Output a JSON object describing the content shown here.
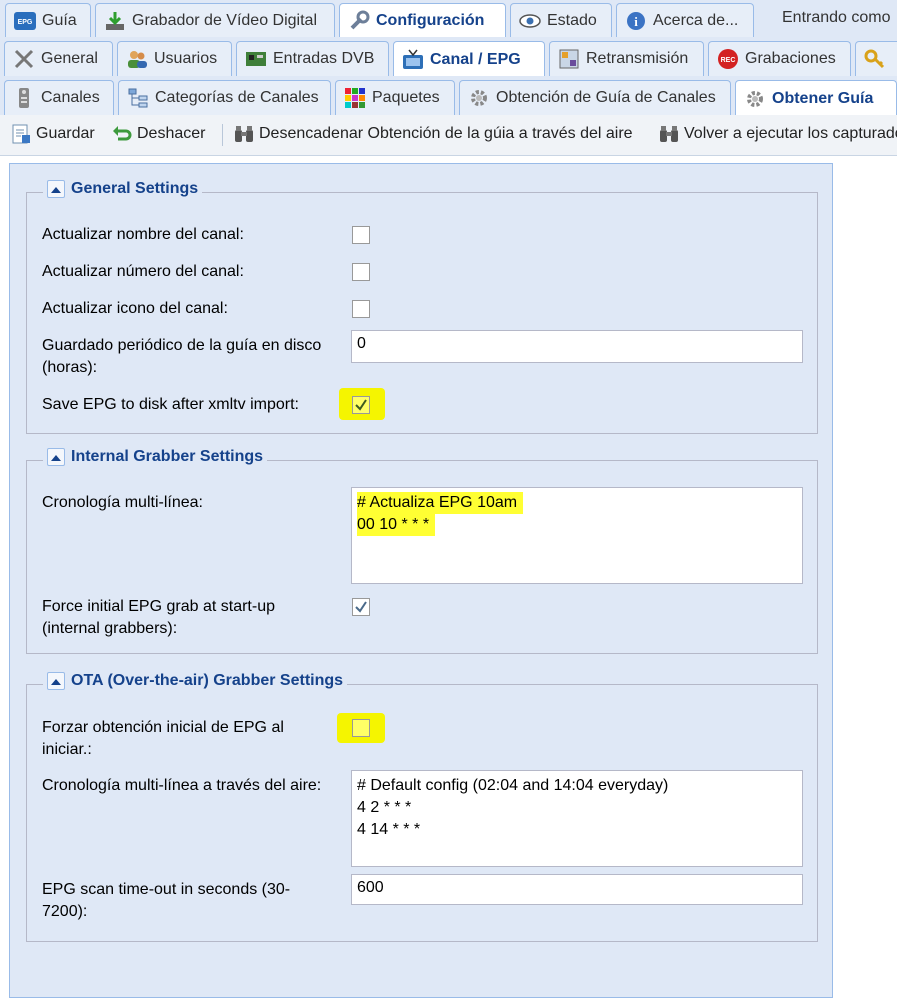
{
  "tabs_main": [
    {
      "label": "Guía",
      "icon": "epg-icon"
    },
    {
      "label": "Grabador de Vídeo Digital",
      "icon": "download-icon"
    },
    {
      "label": "Configuración",
      "icon": "wrench-icon"
    },
    {
      "label": "Estado",
      "icon": "eye-icon"
    },
    {
      "label": "Acerca de...",
      "icon": "info-icon"
    }
  ],
  "login_text": "Entrando como",
  "tabs_config": [
    {
      "label": "General",
      "icon": "tools-icon"
    },
    {
      "label": "Usuarios",
      "icon": "users-icon"
    },
    {
      "label": "Entradas DVB",
      "icon": "dvb-card-icon"
    },
    {
      "label": "Canal / EPG",
      "icon": "tv-icon"
    },
    {
      "label": "Retransmisión",
      "icon": "stream-icon"
    },
    {
      "label": "Grabaciones",
      "icon": "rec-icon"
    }
  ],
  "tabs_channel": [
    {
      "label": "Canales",
      "icon": "remote-icon"
    },
    {
      "label": "Categorías de Canales",
      "icon": "tree-icon"
    },
    {
      "label": "Paquetes",
      "icon": "bouquet-icon"
    },
    {
      "label": "Obtención de Guía de Canales",
      "icon": "gear-icon"
    },
    {
      "label": "Obtener Guía",
      "icon": "gear-icon"
    }
  ],
  "toolbar": {
    "save": "Guardar",
    "undo": "Deshacer",
    "trigger_ota": "Desencadenar Obtención de la gúia a través del aire",
    "rerun": "Volver a ejecutar los capturado"
  },
  "general_settings": {
    "title": "General Settings",
    "update_name_label": "Actualizar nombre del canal:",
    "update_name_checked": false,
    "update_number_label": "Actualizar número del canal:",
    "update_number_checked": false,
    "update_icon_label": "Actualizar icono del canal:",
    "update_icon_checked": false,
    "periodic_save_label": "Guardado periódico de la guía en disco (horas):",
    "periodic_save_value": "0",
    "save_after_xmltv_label": "Save EPG to disk after xmltv import:",
    "save_after_xmltv_checked": true
  },
  "internal_grabber": {
    "title": "Internal Grabber Settings",
    "cron_label": "Cronología multi-línea:",
    "cron_lines": [
      "# Actualiza EPG 10am",
      "00 10 * * *"
    ],
    "force_initial_label": "Force initial EPG grab at start-up (internal grabbers):",
    "force_initial_checked": true
  },
  "ota_grabber": {
    "title": "OTA (Over-the-air) Grabber Settings",
    "force_initial_label": "Forzar obtención inicial de EPG al iniciar.:",
    "force_initial_checked": false,
    "cron_label": "Cronología multi-línea a través del aire:",
    "cron_lines": [
      "# Default config (02:04 and 14:04 everyday)",
      "4 2 * * *",
      "4 14 * * *"
    ],
    "timeout_label": "EPG scan time-out in seconds (30-7200):",
    "timeout_value": "600"
  },
  "colors": {
    "header_bg": "#dfe8f6",
    "accent_text": "#15428b",
    "highlight": "#ffff33"
  }
}
